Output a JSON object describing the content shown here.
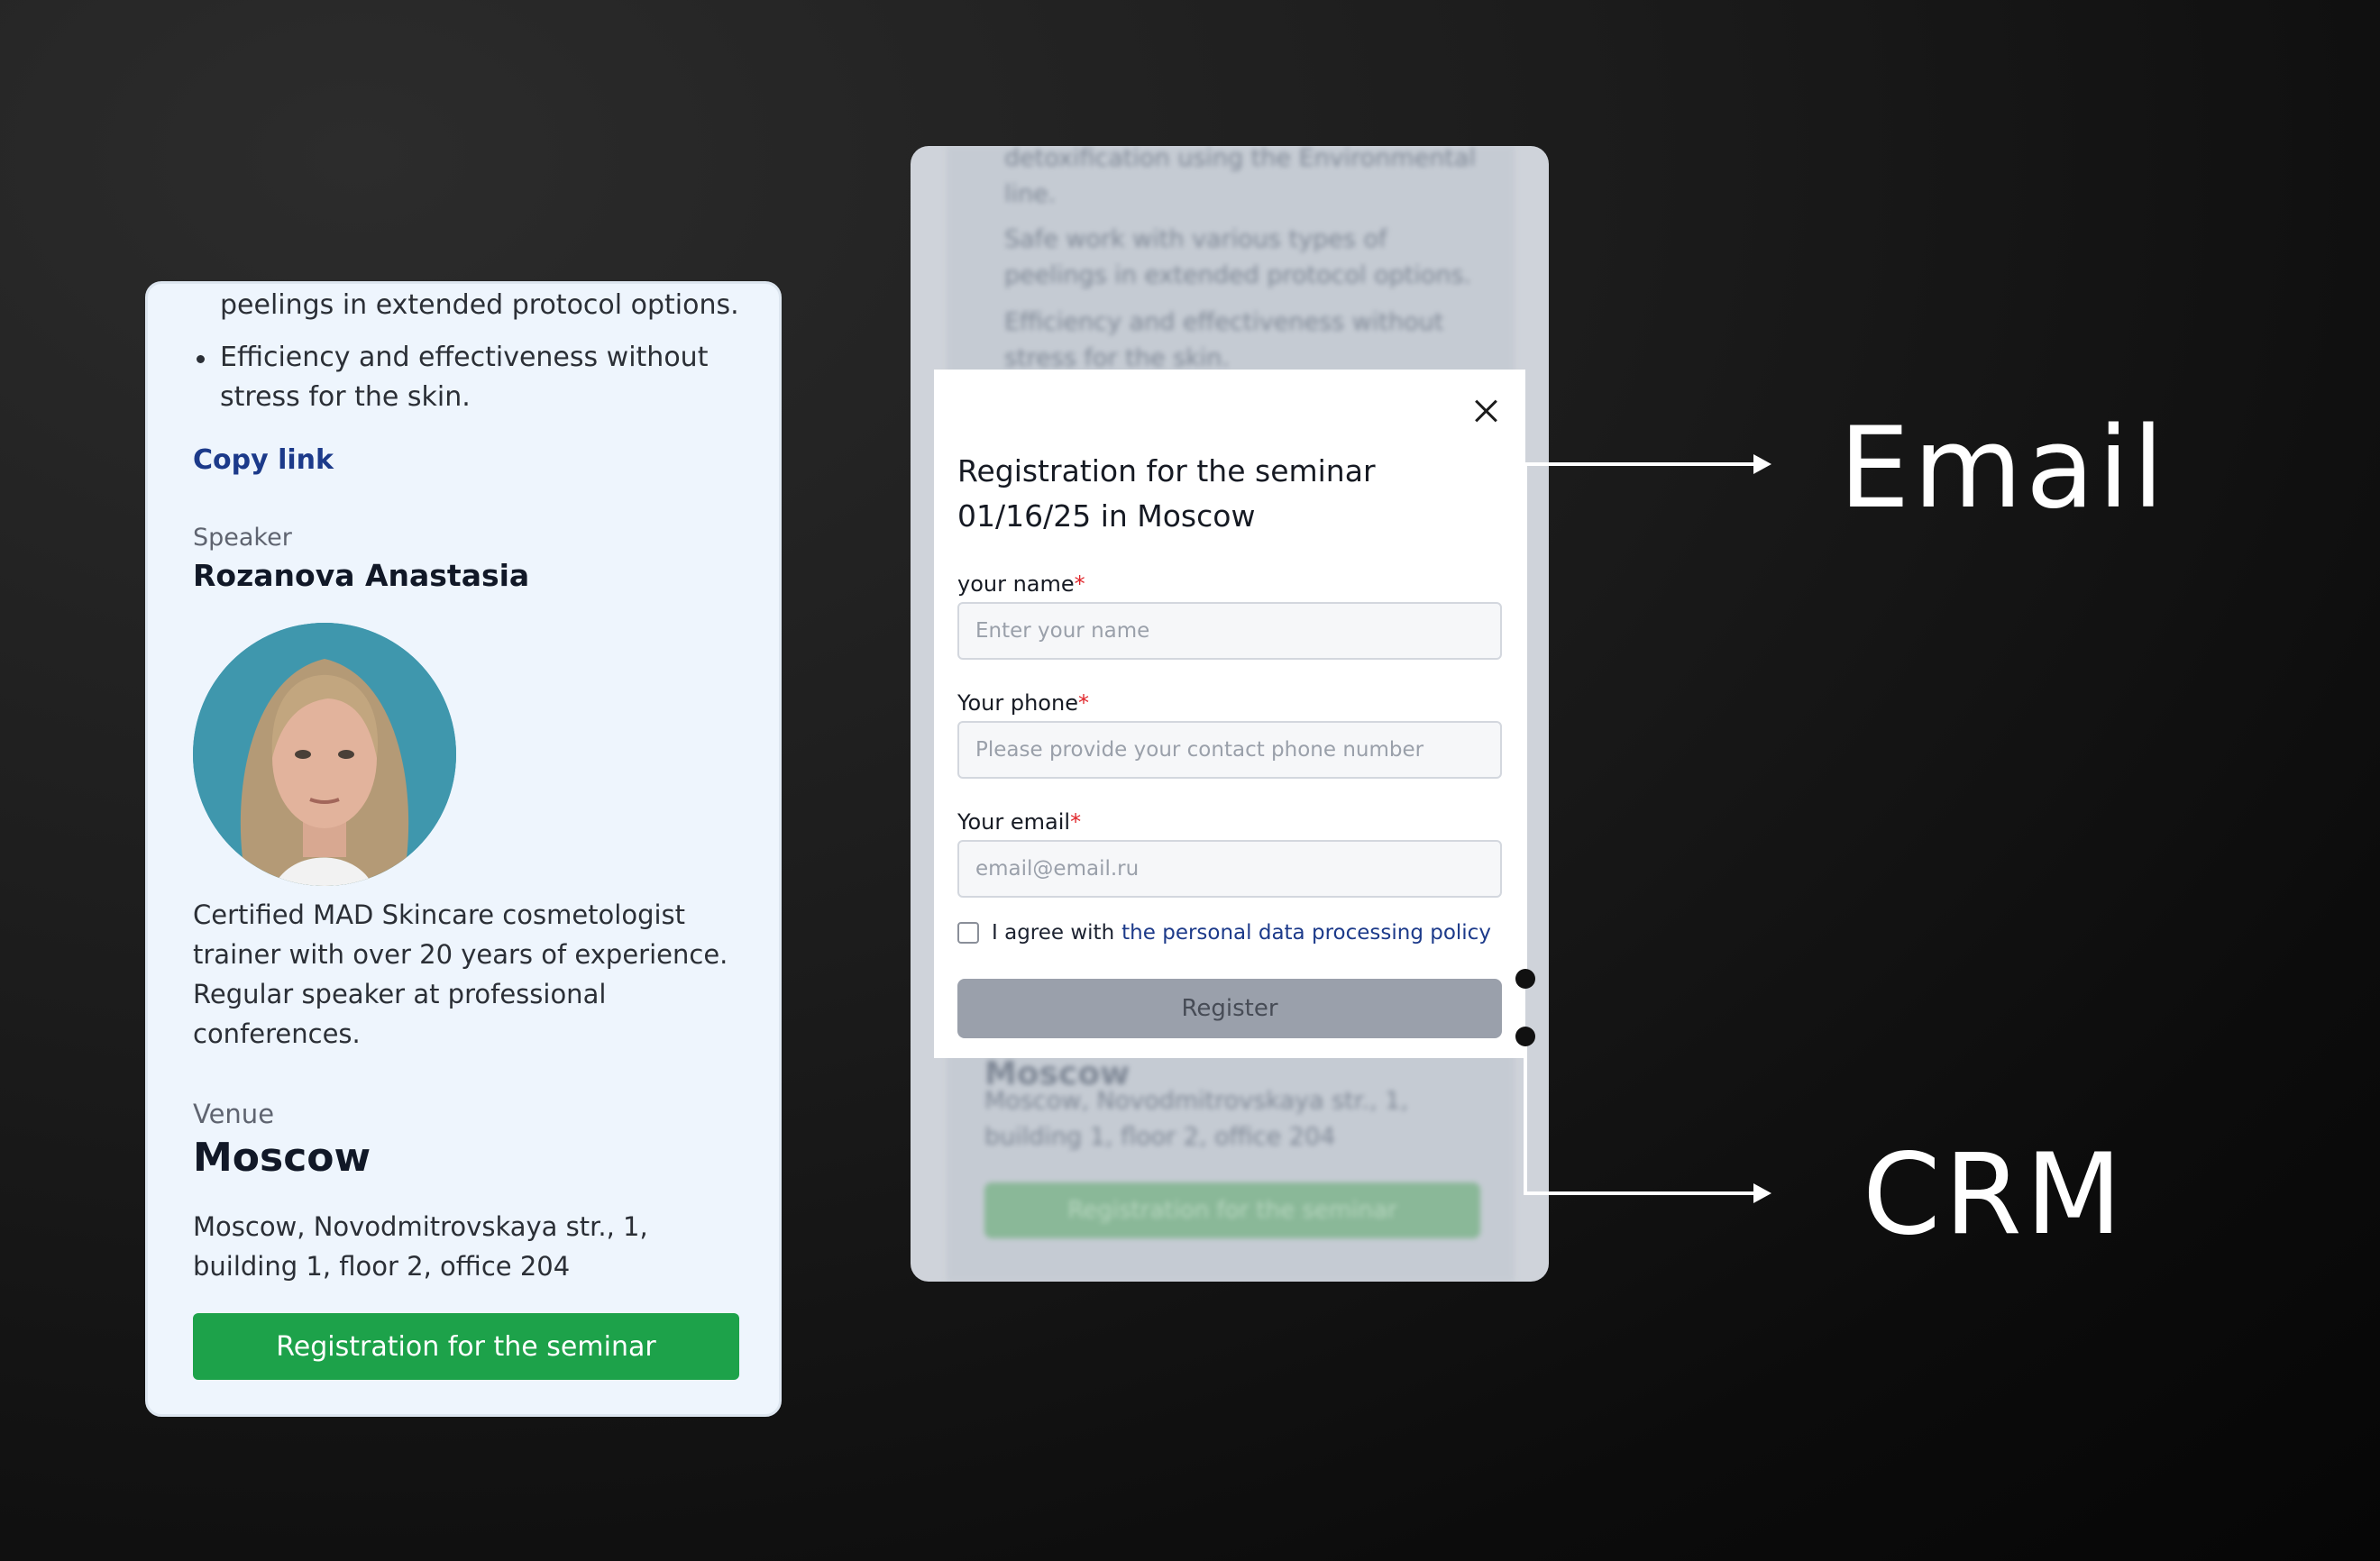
{
  "left_card": {
    "bullet_tail": "peelings in extended protocol options.",
    "bullet_line": "Efficiency and effectiveness without stress for the skin.",
    "copy_link": "Copy link",
    "speaker_label": "Speaker",
    "speaker_name": "Rozanova Anastasia",
    "speaker_bio": "Certified MAD Skincare cosmetologist trainer with over 20 years of experience. Regular speaker at professional conferences.",
    "venue_label": "Venue",
    "venue_city": "Moscow",
    "venue_address": "Moscow, Novodmitrovskaya str., 1, building 1, floor 2, office 204",
    "register_button": "Registration for the seminar"
  },
  "background_page": {
    "line1": "detoxification using the Environmental",
    "line2": "line.",
    "bullet1": "Safe work with various types of peelings in extended protocol options.",
    "bullet2": "Efficiency and effectiveness without stress for the skin.",
    "city": "Moscow",
    "address": "Moscow, Novodmitrovskaya str., 1, building 1, floor 2, office 204",
    "register_button": "Registration for the seminar"
  },
  "modal": {
    "title": "Registration for the seminar 01/16/25 in Moscow",
    "name_label": "your name",
    "name_placeholder": "Enter your name",
    "phone_label": "Your phone",
    "phone_placeholder": "Please provide your contact phone number",
    "email_label": "Your email",
    "email_placeholder": "email@email.ru",
    "required_mark": "*",
    "agree_text": "I agree with",
    "policy_link": "the personal data processing policy",
    "submit_button": "Register"
  },
  "destinations": {
    "email": "Email",
    "crm": "CRM"
  },
  "colors": {
    "accent_green": "#1da24a",
    "link_blue": "#1c3a8a",
    "required_red": "#e0262b"
  }
}
